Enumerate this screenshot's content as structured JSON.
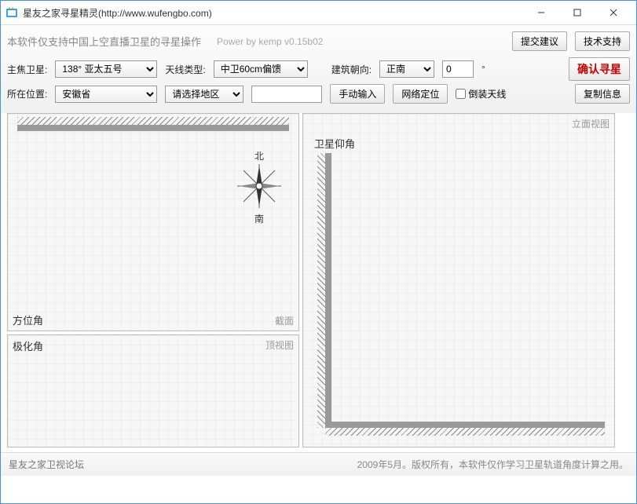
{
  "window": {
    "title": "星友之家寻星精灵(http://www.wufengbo.com)"
  },
  "header": {
    "hint": "本软件仅支持中国上空直播卫星的寻星操作",
    "powered": "Power by kemp  v0.15b02",
    "suggest": "提交建议",
    "support": "技术支持"
  },
  "ctrl": {
    "satlbl": "主焦卫星:",
    "sat": "138°  亚太五号",
    "anttypelbl": "天线类型:",
    "anttype": "中卫60cm偏馈",
    "buildlbl": "建筑朝向:",
    "build": "正南",
    "angle": "0",
    "degree": "°",
    "confirm": "确认寻星",
    "loclbl": "所在位置:",
    "prov": "安徽省",
    "region": "请选择地区",
    "manual": "手动输入",
    "netloc": "网络定位",
    "invert": "倒装天线",
    "copy": "复制信息"
  },
  "panels": {
    "p1corner": "截面",
    "p1btm": "方位角",
    "p2corner": "顶视图",
    "p2top": "极化角",
    "p3corner": "立面视图",
    "p3top": "卫星仰角",
    "north": "北",
    "south": "南"
  },
  "footer": {
    "forum": "星友之家卫视论坛",
    "copy": "2009年5月。版权所有，本软件仅作学习卫星轨道角度计算之用。"
  }
}
